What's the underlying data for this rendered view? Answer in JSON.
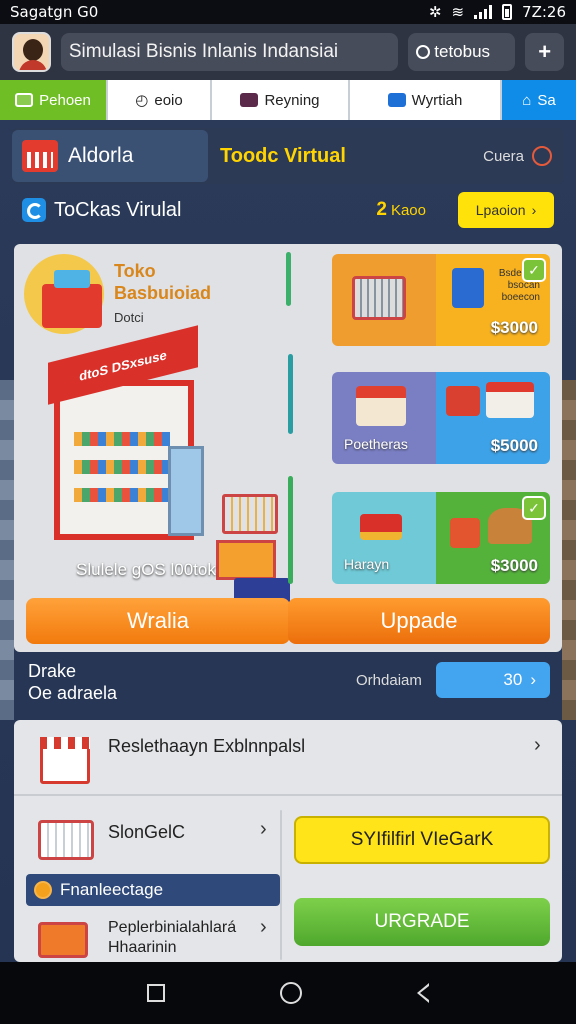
{
  "status_bar": {
    "left_text": "Sagatgn  G0",
    "time": "7Z:26"
  },
  "header": {
    "app_title": "Simulasi Bisnis Inlanis Indansiai",
    "status_label": "tetobus",
    "plus_glyph": "+"
  },
  "tabs": [
    {
      "label": "Pehoen",
      "color": "#6fbe25"
    },
    {
      "label": "eoio",
      "color": "#ffffff"
    },
    {
      "label": "Reyning",
      "color": "#ffffff"
    },
    {
      "label": "Wyrtiah",
      "color": "#ffffff"
    },
    {
      "label": "Sa",
      "color": "#0f8ce8"
    }
  ],
  "top_segment": {
    "left_label": "Aldorla",
    "mid_label": "Toodc Virtual",
    "right_label": "Cuera"
  },
  "subheader": {
    "title": "ToCkas Virulal",
    "count_number": "2",
    "count_label": "Kaoo",
    "button_label": "Lpaoion",
    "button_chevron": "›"
  },
  "store_card": {
    "name": "Toko Basbuioiad",
    "sub": "Dotci",
    "sign": "dtoS DSxsuse",
    "caption": "Slulele gOS l00tok",
    "items": [
      {
        "name": "",
        "price": "$3000",
        "tiny": "Bsde ecs bsocan boeecon",
        "checked": true,
        "left_color": "#ef9d2e",
        "right_color": "#f8b21f"
      },
      {
        "name": "Poetheras",
        "price": "$5000",
        "tiny": "",
        "checked": false,
        "left_color": "#7a7fc4",
        "right_color": "#3da2e8"
      },
      {
        "name": "Harayn",
        "price": "$3000",
        "tiny": "",
        "checked": true,
        "left_color": "#6fc9d6",
        "right_color": "#54b23b"
      }
    ],
    "btn_left": "Wralia",
    "btn_right": "Uppade"
  },
  "orders": {
    "title_line1": "Drake",
    "title_line2": "Oe adraela",
    "label": "Orhdaiam",
    "value": "30",
    "chevron": "›"
  },
  "list": {
    "row1": "Reslethaayn Exblnnpalsl",
    "row2": "SlonGelC",
    "strip_label": "Fnanleectage",
    "row3_line1": "Peplerbinialahlará",
    "row3_line2": "Hhaarinin",
    "btn_yellow": "SYIfilfirl VIeGarK",
    "btn_green": "URGRADE",
    "chevron": "›"
  },
  "icons": {
    "wifi": "wifi-icon",
    "signal": "signal-icon",
    "battery": "battery-icon"
  }
}
